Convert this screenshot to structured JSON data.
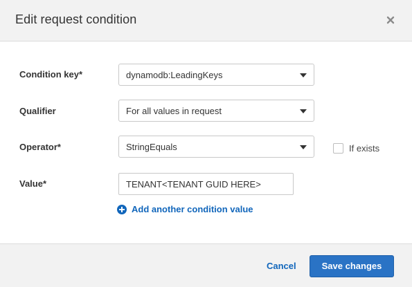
{
  "dialog": {
    "title": "Edit request condition",
    "close_icon": "close-icon"
  },
  "form": {
    "condition_key": {
      "label": "Condition key*",
      "value": "dynamodb:LeadingKeys"
    },
    "qualifier": {
      "label": "Qualifier",
      "value": "For all values in request"
    },
    "operator": {
      "label": "Operator*",
      "value": "StringEquals"
    },
    "if_exists": {
      "label": "If exists",
      "checked": false
    },
    "value": {
      "label": "Value*",
      "input_value": "TENANT<TENANT GUID HERE>"
    },
    "add_value_link": "Add another condition value"
  },
  "footer": {
    "cancel_label": "Cancel",
    "save_label": "Save changes"
  },
  "colors": {
    "primary_button": "#2a73c5",
    "link": "#1166bb"
  }
}
